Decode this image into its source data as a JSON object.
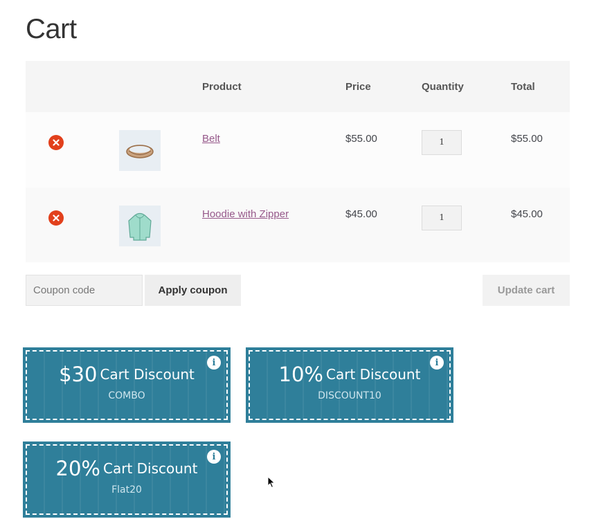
{
  "page": {
    "title": "Cart"
  },
  "table": {
    "headers": {
      "product": "Product",
      "price": "Price",
      "quantity": "Quantity",
      "total": "Total"
    },
    "rows": [
      {
        "name": "Belt",
        "price": "$55.00",
        "qty": "1",
        "total": "$55.00",
        "thumb": "belt-icon"
      },
      {
        "name": "Hoodie with Zipper",
        "price": "$45.00",
        "qty": "1",
        "total": "$45.00",
        "thumb": "hoodie-icon"
      }
    ]
  },
  "actions": {
    "coupon_placeholder": "Coupon code",
    "apply_label": "Apply coupon",
    "update_label": "Update cart"
  },
  "coupons": [
    {
      "amount": "$30",
      "label": "Cart Discount",
      "code": "COMBO"
    },
    {
      "amount": "10%",
      "label": "Cart Discount",
      "code": "DISCOUNT10"
    },
    {
      "amount": "20%",
      "label": "Cart Discount",
      "code": "Flat20"
    }
  ],
  "colors": {
    "coupon_bg": "#2f7f9a",
    "remove": "#e2401c",
    "link": "#96588a"
  }
}
